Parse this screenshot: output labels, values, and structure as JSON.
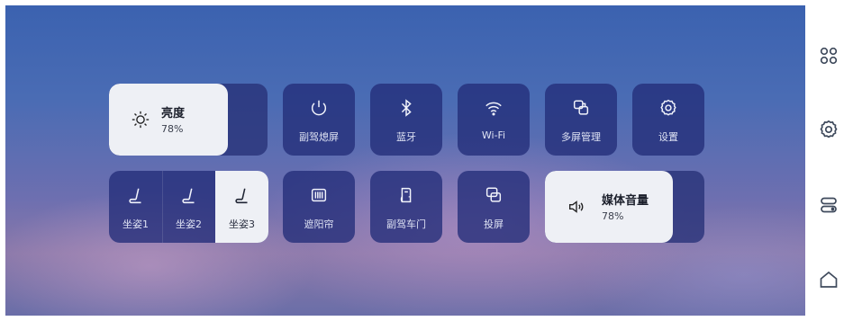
{
  "sidebar": {
    "items": [
      {
        "icon": "grid-icon"
      },
      {
        "icon": "gear-icon"
      },
      {
        "icon": "capsules-icon"
      },
      {
        "icon": "home-icon"
      }
    ]
  },
  "brightness": {
    "icon": "sun-icon",
    "title": "亮度",
    "value": "78%",
    "level": 0.78
  },
  "tiles_row1": [
    {
      "icon": "power-icon",
      "label": "副驾熄屏"
    },
    {
      "icon": "bluetooth-icon",
      "label": "蓝牙"
    },
    {
      "icon": "wifi-icon",
      "label": "Wi-Fi"
    },
    {
      "icon": "multiscreen-icon",
      "label": "多屏管理"
    },
    {
      "icon": "settings-icon",
      "label": "设置"
    }
  ],
  "seats": [
    {
      "icon": "seat-icon",
      "label": "坐姿1",
      "active": false
    },
    {
      "icon": "seat-icon",
      "label": "坐姿2",
      "active": false
    },
    {
      "icon": "seat-icon",
      "label": "坐姿3",
      "active": true
    }
  ],
  "tiles_row2": [
    {
      "icon": "sunshade-icon",
      "label": "遮阳帘"
    },
    {
      "icon": "door-icon",
      "label": "副驾车门"
    },
    {
      "icon": "cast-icon",
      "label": "投屏"
    }
  ],
  "volume": {
    "icon": "speaker-icon",
    "title": "媒体音量",
    "value": "78%",
    "level": 0.78
  }
}
